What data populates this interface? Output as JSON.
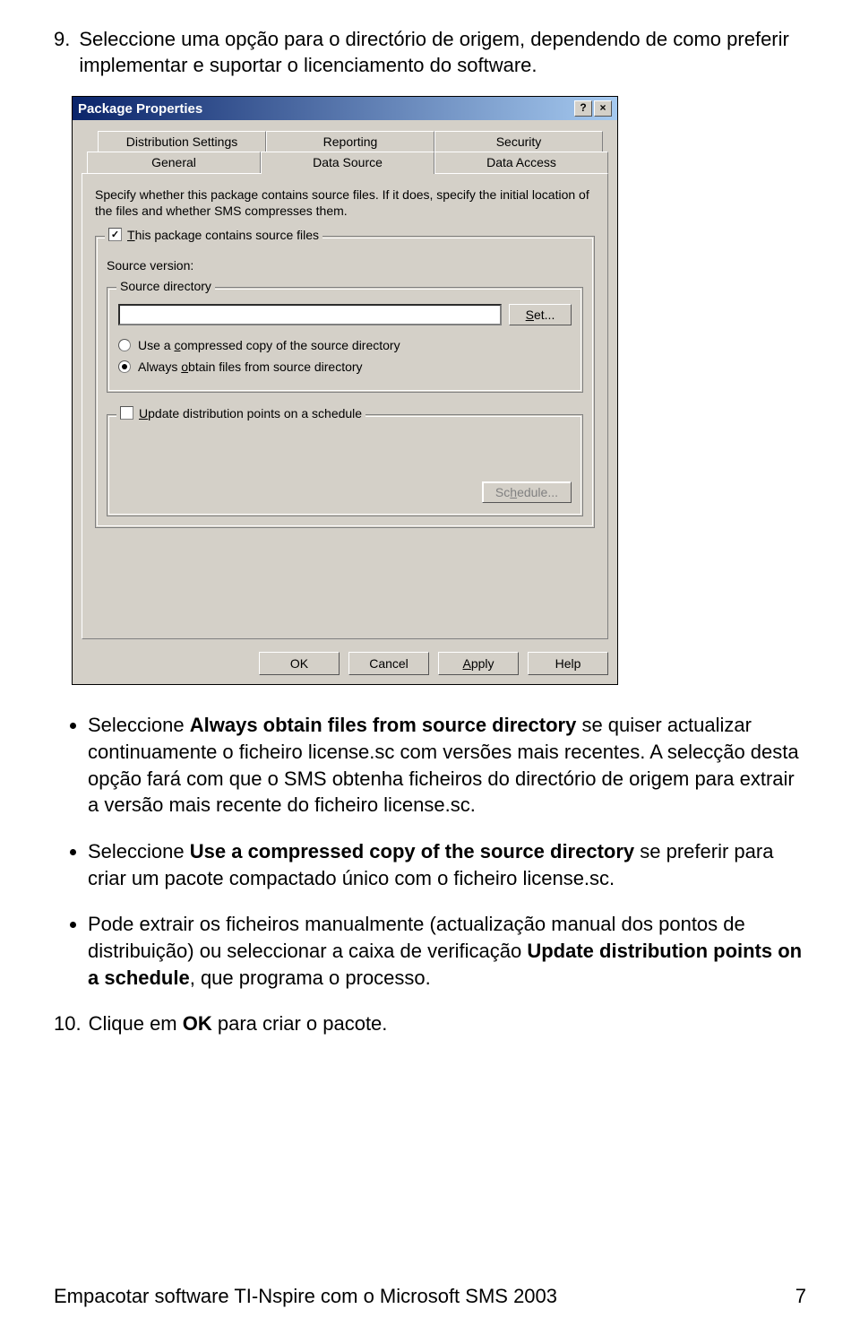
{
  "step9": {
    "num": "9.",
    "text": "Seleccione uma opção para o directório de origem, dependendo de como preferir implementar e suportar o licenciamento do software."
  },
  "dialog": {
    "title": "Package Properties",
    "help_glyph": "?",
    "close_glyph": "×",
    "tabs_row1": [
      "Distribution Settings",
      "Reporting",
      "Security"
    ],
    "tabs_row2": [
      "General",
      "Data Source",
      "Data Access"
    ],
    "description": "Specify whether this package contains source files.  If it does, specify the initial location of the files and whether SMS compresses them.",
    "group_legend_prefix": "T",
    "group_legend": "his package contains source files",
    "checkbox_checked": true,
    "source_version_label": "Source version:",
    "source_dir_legend": "Source directory",
    "set_btn": "Set...",
    "set_prefix": "S",
    "radio_compressed_prefix": "c",
    "radio_compressed": "Use a compressed copy of the source directory",
    "radio_always_prefix": "o",
    "radio_always": "Always obtain files from source directory",
    "update_prefix": "U",
    "update_label": "pdate distribution points on a schedule",
    "schedule_btn": "Schedule...",
    "schedule_prefix": "h",
    "ok": "OK",
    "cancel": "Cancel",
    "apply": "Apply",
    "apply_prefix": "A",
    "help": "Help"
  },
  "bullets": {
    "b1_pre": "Seleccione ",
    "b1_bold": "Always obtain files from source directory",
    "b1_post": " se quiser actualizar continuamente o ficheiro license.sc com versões mais recentes. A selecção desta opção fará com que o SMS obtenha ficheiros do directório de origem para extrair a versão mais recente do ficheiro license.sc.",
    "b2_pre": "Seleccione ",
    "b2_bold": "Use a compressed copy of the source directory",
    "b2_post": " se preferir para criar um pacote compactado único com o ficheiro license.sc.",
    "b3_pre": "Pode extrair os ficheiros manualmente (actualização manual dos pontos de distribuição) ou seleccionar a caixa de verificação ",
    "b3_bold": "Update distribution points on a schedule",
    "b3_post": ", que programa o processo."
  },
  "step10": {
    "num": "10.",
    "pre": "Clique em ",
    "bold": "OK",
    "post": " para criar o pacote."
  },
  "footer": {
    "text": "Empacotar software TI-Nspire com o Microsoft SMS 2003",
    "pagenum": "7"
  }
}
